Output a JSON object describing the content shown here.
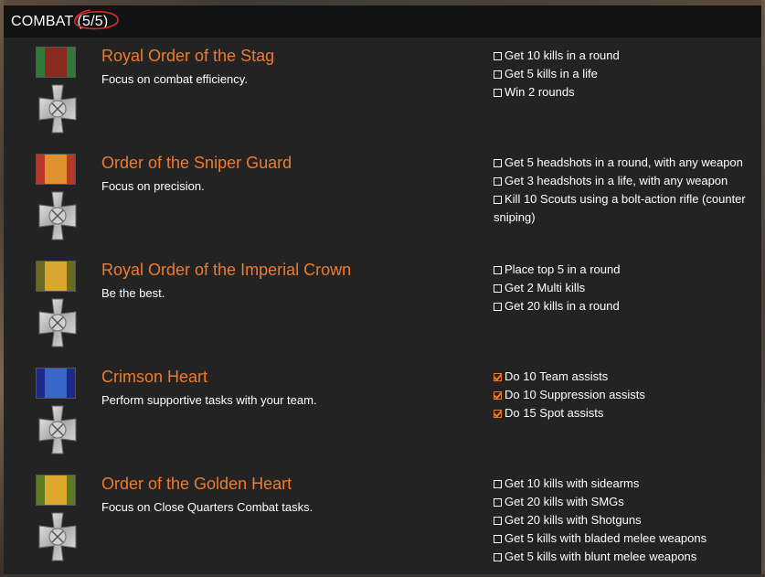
{
  "header": {
    "label": "COMBAT",
    "count": "(5/5)"
  },
  "colors": {
    "accent": "#f07a2c",
    "panel_bg": "#232323",
    "header_bg": "#121212",
    "text": "#ffffff"
  },
  "medals": [
    {
      "title": "Royal Order of the Stag",
      "desc": "Focus on combat efficiency.",
      "ribbon_colors": [
        "#2f7a3a",
        "#8a2a1e",
        "#2f7a3a"
      ],
      "tasks": [
        {
          "text": "Get 10 kills in a round",
          "checked": false
        },
        {
          "text": "Get 5 kills in a life",
          "checked": false
        },
        {
          "text": "Win 2 rounds",
          "checked": false
        }
      ]
    },
    {
      "title": "Order of the Sniper Guard",
      "desc": "Focus on precision.",
      "ribbon_colors": [
        "#b8362a",
        "#e0902e",
        "#b8362a"
      ],
      "tasks": [
        {
          "text": "Get 5 headshots in a round, with any weapon",
          "checked": false
        },
        {
          "text": "Get 3 headshots in a life, with any weapon",
          "checked": false
        },
        {
          "text": "Kill 10 Scouts using a bolt-action rifle (counter sniping)",
          "checked": false
        }
      ]
    },
    {
      "title": "Royal Order of the Imperial Crown",
      "desc": "Be the best.",
      "ribbon_colors": [
        "#6b6a22",
        "#d8a530",
        "#6b6a22"
      ],
      "tasks": [
        {
          "text": "Place top 5 in a round",
          "checked": false
        },
        {
          "text": "Get 2 Multi kills",
          "checked": false
        },
        {
          "text": "Get 20 kills in a round",
          "checked": false
        }
      ]
    },
    {
      "title": "Crimson Heart",
      "desc": "Perform supportive tasks with your team.",
      "ribbon_colors": [
        "#1d2a8a",
        "#3b66c9",
        "#1d2a8a"
      ],
      "tasks": [
        {
          "text": "Do 10 Team assists",
          "checked": true
        },
        {
          "text": "Do 10 Suppression assists",
          "checked": true
        },
        {
          "text": "Do 15 Spot assists",
          "checked": true
        }
      ]
    },
    {
      "title": "Order of the Golden Heart",
      "desc": "Focus on Close Quarters Combat tasks.",
      "ribbon_colors": [
        "#5d7a24",
        "#e0a82c",
        "#5d7a24"
      ],
      "tasks": [
        {
          "text": "Get 10 kills with sidearms",
          "checked": false
        },
        {
          "text": "Get 20 kills with SMGs",
          "checked": false
        },
        {
          "text": "Get 20 kills with Shotguns",
          "checked": false
        },
        {
          "text": "Get 5 kills with bladed melee weapons",
          "checked": false
        },
        {
          "text": "Get 5 kills with blunt melee weapons",
          "checked": false
        }
      ]
    }
  ]
}
